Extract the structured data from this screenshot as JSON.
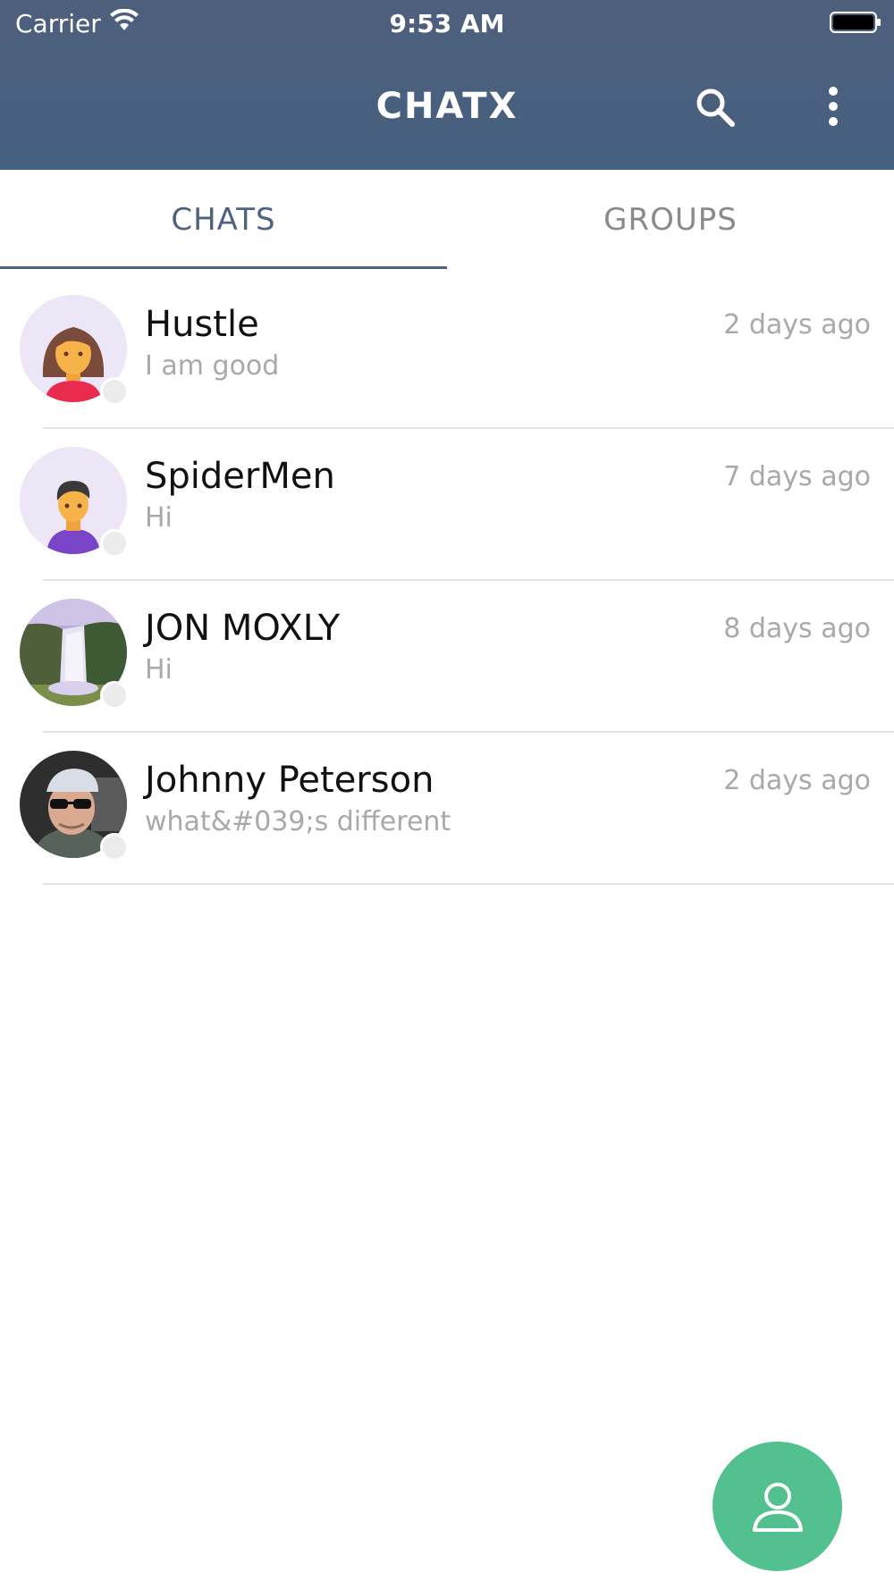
{
  "status_bar": {
    "carrier": "Carrier",
    "time": "9:53 AM"
  },
  "header": {
    "title": "CHATX",
    "search_icon": "search-icon",
    "menu_icon": "more-vertical-icon"
  },
  "tabs": [
    {
      "label": "CHATS",
      "active": true
    },
    {
      "label": "GROUPS",
      "active": false
    }
  ],
  "chats": [
    {
      "name": "Hustle",
      "message": "I am good",
      "time": "2 days ago",
      "avatar": "female-avatar"
    },
    {
      "name": "SpiderMen",
      "message": "Hi",
      "time": "7 days ago",
      "avatar": "male-avatar"
    },
    {
      "name": "JON MOXLY",
      "message": "Hi",
      "time": "8 days ago",
      "avatar": "waterfall-photo"
    },
    {
      "name": "Johnny Peterson",
      "message": "what&#039;s different",
      "time": "2 days ago",
      "avatar": "man-photo"
    }
  ],
  "fab": {
    "icon": "person-icon"
  },
  "colors": {
    "header": "#4a6080",
    "accent": "#4d6280",
    "fab": "#52c18f"
  }
}
